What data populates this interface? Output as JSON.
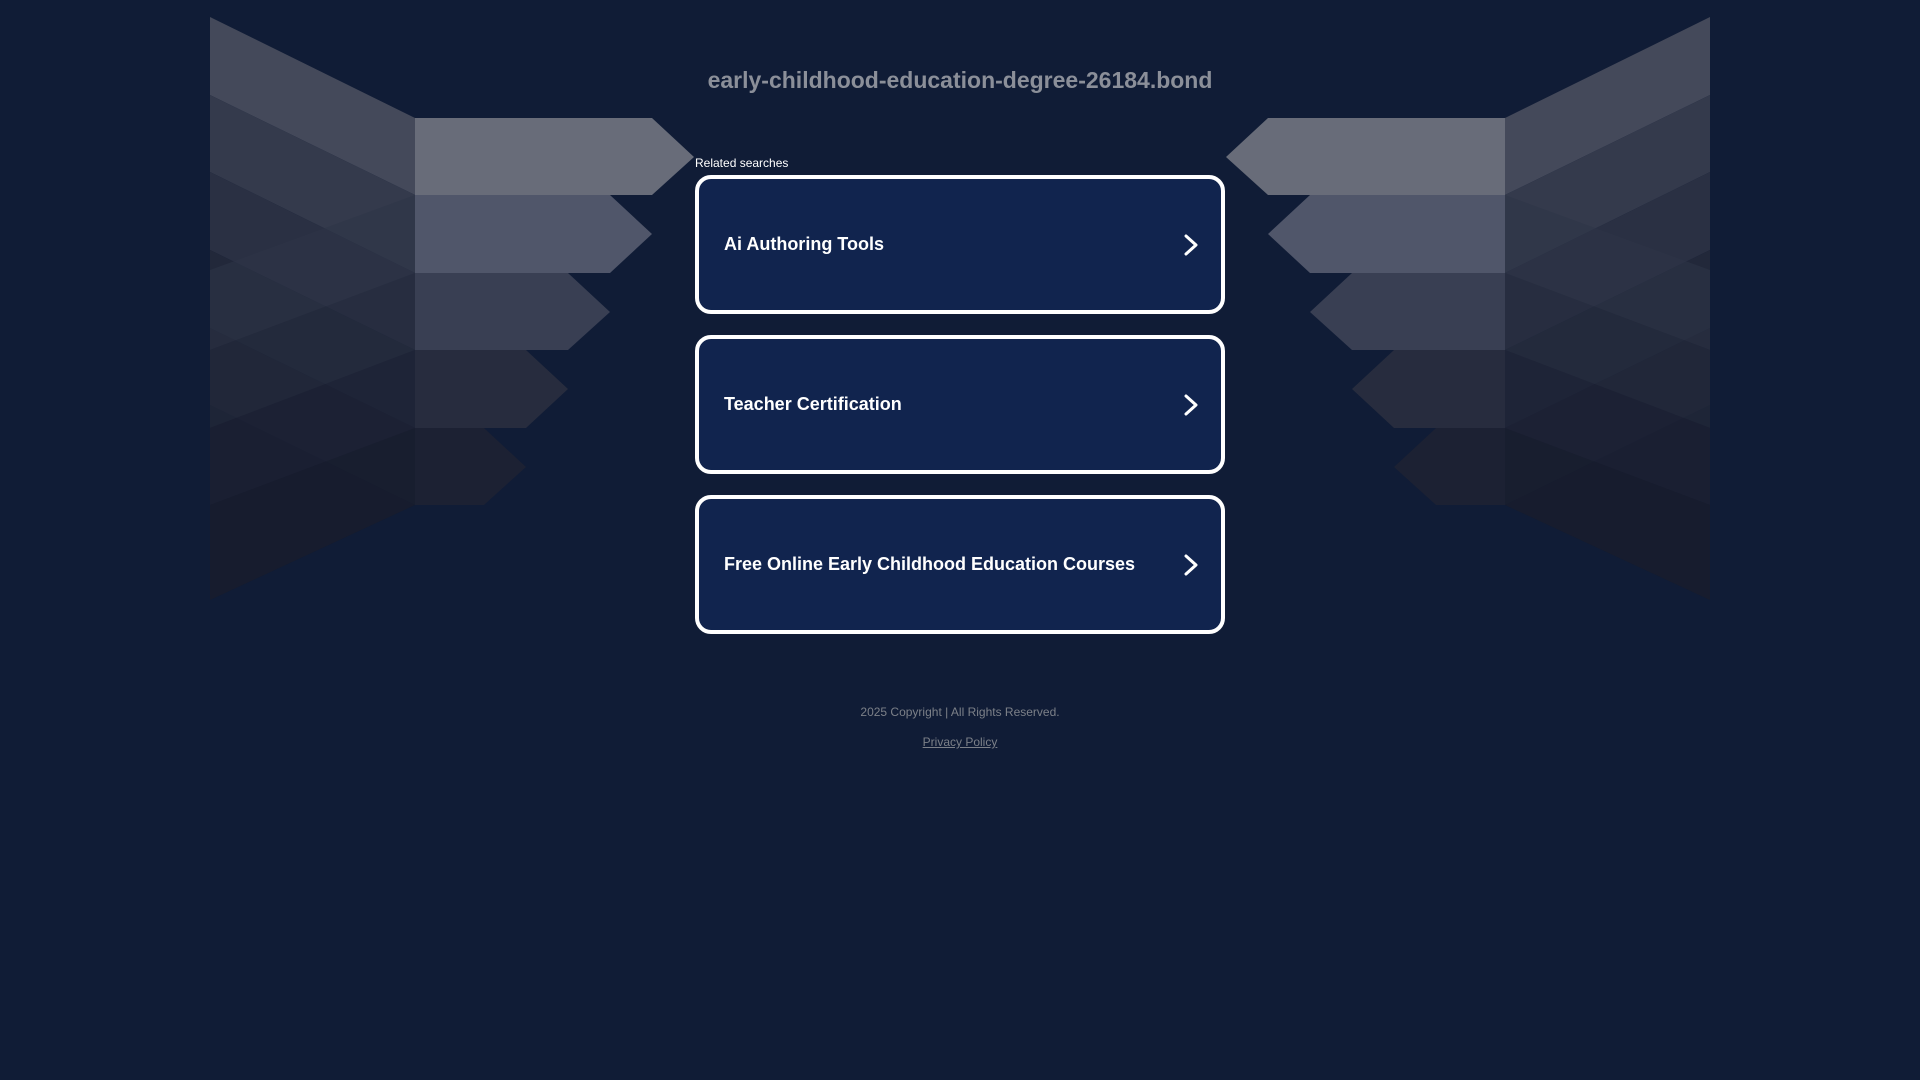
{
  "page": {
    "domain_title": "early-childhood-education-degree-26184.bond",
    "related_label": "Related searches",
    "background_color": "#101c36",
    "card_color": "#11244e"
  },
  "results": [
    {
      "label": "Ai Authoring Tools",
      "icon": "chevron-right-icon"
    },
    {
      "label": "Teacher Certification",
      "icon": "chevron-right-icon"
    },
    {
      "label": "Free Online Early Childhood Education Courses",
      "icon": "chevron-right-icon"
    }
  ],
  "footer": {
    "copyright": "2025 Copyright | All Rights Reserved.",
    "privacy_link": "Privacy Policy"
  }
}
